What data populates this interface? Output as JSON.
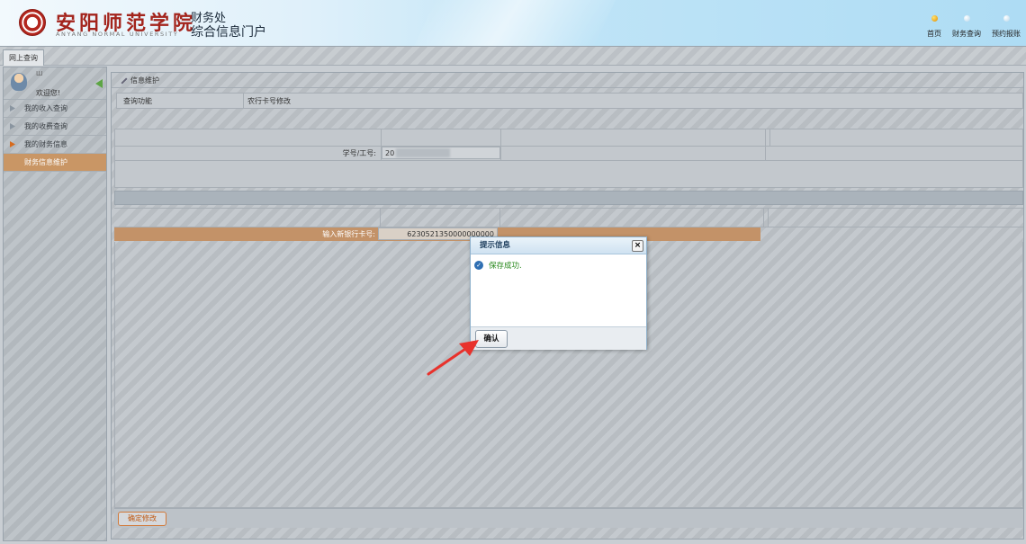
{
  "header": {
    "school_cn": "安阳师范学院",
    "school_en": "ANYANG NORMAL UNIVERSITY",
    "dept_line1": "财务处",
    "dept_line2": "综合信息门户",
    "nav": [
      {
        "label": "首页",
        "icon": "home-dot-icon"
      },
      {
        "label": "财务查询",
        "icon": "dot-icon"
      },
      {
        "label": "预约报账",
        "icon": "dot-icon"
      }
    ]
  },
  "tabs": [
    {
      "label": "网上查询"
    }
  ],
  "sidebar": {
    "user_name": "Ш",
    "welcome": "欢迎您!",
    "items": [
      {
        "label": "我的收入查询"
      },
      {
        "label": "我的收费查询"
      },
      {
        "label": "我的财务信息"
      },
      {
        "label": "财务信息维护"
      }
    ]
  },
  "main": {
    "panel_title": "信息维护",
    "query_label": "查询功能",
    "query_value": "农行卡号修改",
    "id_label": "学号/工号:",
    "id_value": "20",
    "card_label": "输入新银行卡号:",
    "card_value": "6230521350000000000",
    "confirm_button": "确定修改"
  },
  "modal": {
    "title": "提示信息",
    "close": "×",
    "message": "保存成功.",
    "ok_button": "确认"
  },
  "colors": {
    "accent_red": "#a3241c",
    "active_menu": "#c99665",
    "success_green": "#2b8a1f",
    "arrow_red": "#e8322c"
  }
}
